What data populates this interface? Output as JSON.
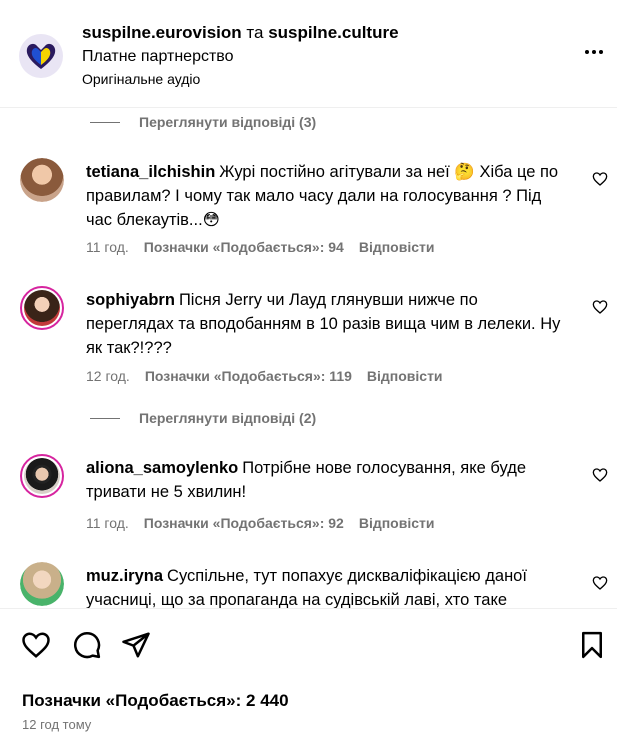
{
  "header": {
    "account1": "suspilne.eurovision",
    "connector": "та",
    "account2": "suspilne.culture",
    "subtitle": "Платне партнерство",
    "audio": "Оригінальне аудіо"
  },
  "view_replies_1": "Переглянути відповіді (3)",
  "view_replies_2": "Переглянути відповіді (2)",
  "comments": [
    {
      "username": "tetiana_ilchishin",
      "text": "Журі постійно агітували за неї 🤔 Хіба це по правилам? І чому так мало часу дали на голосування ? Під час блекаутів...😳",
      "time": "11 год.",
      "likes": "Позначки «Подобається»: 94",
      "reply": "Відповісти"
    },
    {
      "username": "sophiyabrn",
      "text": "Пісня Jerry чи Лауд глянувши нижче по переглядах та вподобанням в 10 разів вища чим в лелеки. Ну як так?!???",
      "time": "12 год.",
      "likes": "Позначки «Подобається»: 119",
      "reply": "Відповісти"
    },
    {
      "username": "aliona_samoylenko",
      "text": "Потрібне нове голосування, яке буде тривати не 5 хвилин!",
      "time": "11 год.",
      "likes": "Позначки «Подобається»: 92",
      "reply": "Відповісти"
    },
    {
      "username": "muz.iryna",
      "text": "Суспільне, тут попахує дискваліфікацією даної учасниці, що за пропаганда на судівській лаві, хто таке"
    }
  ],
  "footer": {
    "likes": "Позначки «Подобається»: 2 440",
    "time": "12 год тому"
  },
  "colors": {
    "secondary_text": "#737373",
    "story_ring": "#d6249f",
    "brand_blue": "#1f4fd1",
    "brand_yellow": "#f5d300"
  }
}
